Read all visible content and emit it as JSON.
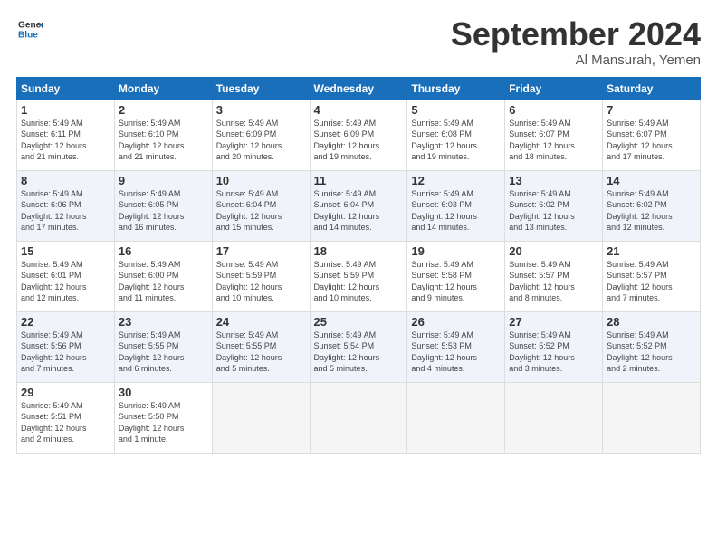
{
  "header": {
    "logo_line1": "General",
    "logo_line2": "Blue",
    "month_title": "September 2024",
    "location": "Al Mansurah, Yemen"
  },
  "weekdays": [
    "Sunday",
    "Monday",
    "Tuesday",
    "Wednesday",
    "Thursday",
    "Friday",
    "Saturday"
  ],
  "weeks": [
    [
      {
        "day": "1",
        "info": "Sunrise: 5:49 AM\nSunset: 6:11 PM\nDaylight: 12 hours\nand 21 minutes."
      },
      {
        "day": "2",
        "info": "Sunrise: 5:49 AM\nSunset: 6:10 PM\nDaylight: 12 hours\nand 21 minutes."
      },
      {
        "day": "3",
        "info": "Sunrise: 5:49 AM\nSunset: 6:09 PM\nDaylight: 12 hours\nand 20 minutes."
      },
      {
        "day": "4",
        "info": "Sunrise: 5:49 AM\nSunset: 6:09 PM\nDaylight: 12 hours\nand 19 minutes."
      },
      {
        "day": "5",
        "info": "Sunrise: 5:49 AM\nSunset: 6:08 PM\nDaylight: 12 hours\nand 19 minutes."
      },
      {
        "day": "6",
        "info": "Sunrise: 5:49 AM\nSunset: 6:07 PM\nDaylight: 12 hours\nand 18 minutes."
      },
      {
        "day": "7",
        "info": "Sunrise: 5:49 AM\nSunset: 6:07 PM\nDaylight: 12 hours\nand 17 minutes."
      }
    ],
    [
      {
        "day": "8",
        "info": "Sunrise: 5:49 AM\nSunset: 6:06 PM\nDaylight: 12 hours\nand 17 minutes."
      },
      {
        "day": "9",
        "info": "Sunrise: 5:49 AM\nSunset: 6:05 PM\nDaylight: 12 hours\nand 16 minutes."
      },
      {
        "day": "10",
        "info": "Sunrise: 5:49 AM\nSunset: 6:04 PM\nDaylight: 12 hours\nand 15 minutes."
      },
      {
        "day": "11",
        "info": "Sunrise: 5:49 AM\nSunset: 6:04 PM\nDaylight: 12 hours\nand 14 minutes."
      },
      {
        "day": "12",
        "info": "Sunrise: 5:49 AM\nSunset: 6:03 PM\nDaylight: 12 hours\nand 14 minutes."
      },
      {
        "day": "13",
        "info": "Sunrise: 5:49 AM\nSunset: 6:02 PM\nDaylight: 12 hours\nand 13 minutes."
      },
      {
        "day": "14",
        "info": "Sunrise: 5:49 AM\nSunset: 6:02 PM\nDaylight: 12 hours\nand 12 minutes."
      }
    ],
    [
      {
        "day": "15",
        "info": "Sunrise: 5:49 AM\nSunset: 6:01 PM\nDaylight: 12 hours\nand 12 minutes."
      },
      {
        "day": "16",
        "info": "Sunrise: 5:49 AM\nSunset: 6:00 PM\nDaylight: 12 hours\nand 11 minutes."
      },
      {
        "day": "17",
        "info": "Sunrise: 5:49 AM\nSunset: 5:59 PM\nDaylight: 12 hours\nand 10 minutes."
      },
      {
        "day": "18",
        "info": "Sunrise: 5:49 AM\nSunset: 5:59 PM\nDaylight: 12 hours\nand 10 minutes."
      },
      {
        "day": "19",
        "info": "Sunrise: 5:49 AM\nSunset: 5:58 PM\nDaylight: 12 hours\nand 9 minutes."
      },
      {
        "day": "20",
        "info": "Sunrise: 5:49 AM\nSunset: 5:57 PM\nDaylight: 12 hours\nand 8 minutes."
      },
      {
        "day": "21",
        "info": "Sunrise: 5:49 AM\nSunset: 5:57 PM\nDaylight: 12 hours\nand 7 minutes."
      }
    ],
    [
      {
        "day": "22",
        "info": "Sunrise: 5:49 AM\nSunset: 5:56 PM\nDaylight: 12 hours\nand 7 minutes."
      },
      {
        "day": "23",
        "info": "Sunrise: 5:49 AM\nSunset: 5:55 PM\nDaylight: 12 hours\nand 6 minutes."
      },
      {
        "day": "24",
        "info": "Sunrise: 5:49 AM\nSunset: 5:55 PM\nDaylight: 12 hours\nand 5 minutes."
      },
      {
        "day": "25",
        "info": "Sunrise: 5:49 AM\nSunset: 5:54 PM\nDaylight: 12 hours\nand 5 minutes."
      },
      {
        "day": "26",
        "info": "Sunrise: 5:49 AM\nSunset: 5:53 PM\nDaylight: 12 hours\nand 4 minutes."
      },
      {
        "day": "27",
        "info": "Sunrise: 5:49 AM\nSunset: 5:52 PM\nDaylight: 12 hours\nand 3 minutes."
      },
      {
        "day": "28",
        "info": "Sunrise: 5:49 AM\nSunset: 5:52 PM\nDaylight: 12 hours\nand 2 minutes."
      }
    ],
    [
      {
        "day": "29",
        "info": "Sunrise: 5:49 AM\nSunset: 5:51 PM\nDaylight: 12 hours\nand 2 minutes."
      },
      {
        "day": "30",
        "info": "Sunrise: 5:49 AM\nSunset: 5:50 PM\nDaylight: 12 hours\nand 1 minute."
      },
      {
        "day": "",
        "info": ""
      },
      {
        "day": "",
        "info": ""
      },
      {
        "day": "",
        "info": ""
      },
      {
        "day": "",
        "info": ""
      },
      {
        "day": "",
        "info": ""
      }
    ]
  ]
}
